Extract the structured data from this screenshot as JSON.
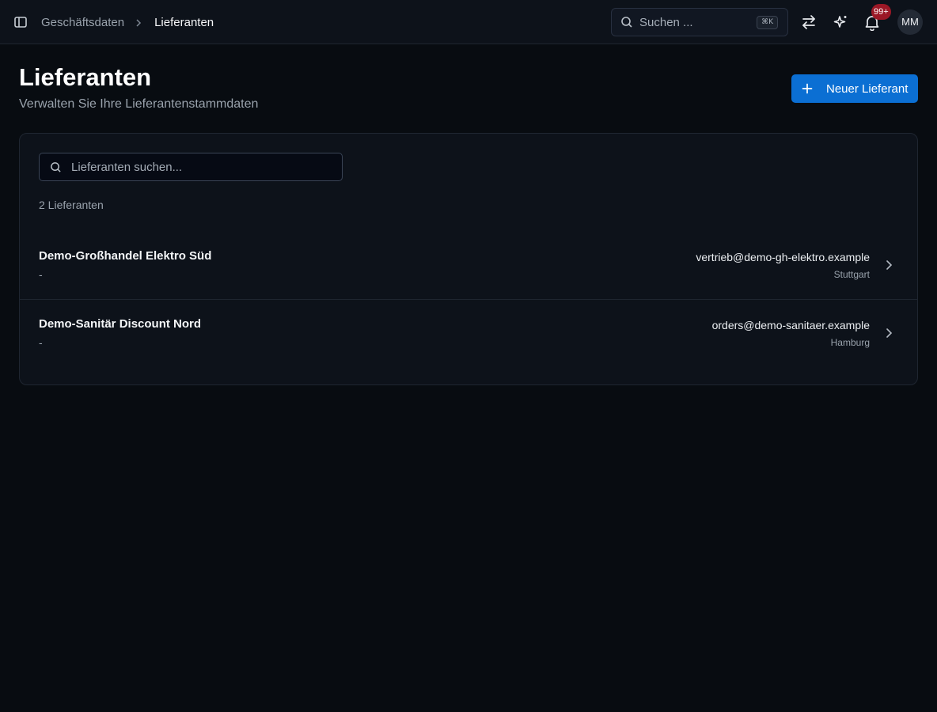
{
  "header": {
    "breadcrumb": {
      "parent": "Geschäftsdaten",
      "current": "Lieferanten"
    },
    "search": {
      "placeholder": "Suchen ...",
      "shortcut": "⌘K"
    },
    "notifications": {
      "badge": "99+",
      "badge_color": "#9b1826"
    },
    "user": {
      "initials": "MM"
    }
  },
  "page": {
    "title": "Lieferanten",
    "subtitle": "Verwalten Sie Ihre Lieferantenstammdaten",
    "new_button_label": "Neuer Lieferant",
    "accent_color": "#0b6fd3"
  },
  "list": {
    "search_placeholder": "Lieferanten suchen...",
    "count_label": "2 Lieferanten",
    "items": [
      {
        "name": "Demo-Großhandel Elektro Süd",
        "sub": "-",
        "email": "vertrieb@demo-gh-elektro.example",
        "city": "Stuttgart"
      },
      {
        "name": "Demo-Sanitär Discount Nord",
        "sub": "-",
        "email": "orders@demo-sanitaer.example",
        "city": "Hamburg"
      }
    ]
  },
  "icons": {
    "sidebar_toggle": "sidebar-toggle-icon",
    "breadcrumb_separator": "chevron-right-icon",
    "search": "search-icon",
    "switch": "arrows-swap-icon",
    "ai": "sparkles-icon",
    "notifications": "bell-icon",
    "add": "plus-icon",
    "row_open": "chevron-right-icon"
  }
}
